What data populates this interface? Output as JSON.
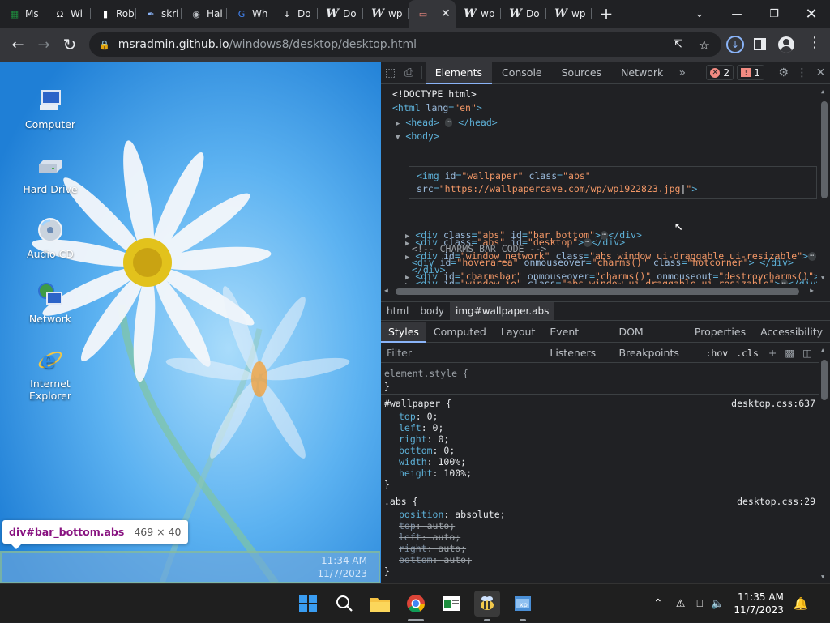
{
  "tabs": [
    {
      "title": "Ms",
      "icon": "green-app-icon",
      "color": "#1e8e3e"
    },
    {
      "title": "Wi",
      "icon": "wiki-icon",
      "color": "#ffffff"
    },
    {
      "title": "Rob",
      "icon": "roblox-icon",
      "color": "#ffffff"
    },
    {
      "title": "skri",
      "icon": "pen-icon",
      "color": "#8ab4f8"
    },
    {
      "title": "Hal",
      "icon": "globe-icon",
      "color": "#bdc1c6"
    },
    {
      "title": "Wh",
      "icon": "google-icon",
      "color": "#4285f4"
    },
    {
      "title": "Do",
      "icon": "download-icon",
      "color": "#e8eaed"
    },
    {
      "title": "Do",
      "icon": "wordpress-w-icon",
      "color": "#e8eaed"
    },
    {
      "title": "wp",
      "icon": "wordpress-w-icon",
      "color": "#e8eaed"
    },
    {
      "title": "",
      "icon": "devtools-screen-icon",
      "color": "#f28b82",
      "active": true
    },
    {
      "title": "wp",
      "icon": "wordpress-w-icon",
      "color": "#e8eaed"
    },
    {
      "title": "Do",
      "icon": "wordpress-w-icon",
      "color": "#e8eaed"
    },
    {
      "title": "wp",
      "icon": "wordpress-w-icon",
      "color": "#e8eaed"
    }
  ],
  "address": {
    "host": "msradmin.github.io",
    "path": "/windows8/desktop/desktop.html"
  },
  "desktop_icons": [
    {
      "label": "Computer",
      "icon": "computer-icon"
    },
    {
      "label": "Hard Drive",
      "icon": "hard-drive-icon"
    },
    {
      "label": "Audio CD",
      "icon": "audio-cd-icon"
    },
    {
      "label": "Network",
      "icon": "network-icon"
    },
    {
      "label": "Internet Explorer",
      "icon": "internet-explorer-icon"
    }
  ],
  "tooltip": {
    "tag": "div#bar_bottom.abs",
    "dims": "469 × 40"
  },
  "page_clock": {
    "time": "11:34 AM",
    "date": "11/7/2023"
  },
  "devtools": {
    "tabs": [
      "Elements",
      "Console",
      "Sources",
      "Network"
    ],
    "errors": "2",
    "issues": "1",
    "breadcrumbs": [
      "html",
      "body",
      "img#wallpaper.abs"
    ],
    "style_tabs": [
      "Styles",
      "Computed",
      "Layout",
      "Event Listeners",
      "DOM Breakpoints",
      "Properties",
      "Accessibility"
    ],
    "filter_placeholder": "Filter",
    "filter_hov": ":hov",
    "filter_cls": ".cls",
    "rule_wallpaper": {
      "selector": "#wallpaper {",
      "source": "desktop.css:637"
    },
    "rule_abs": {
      "selector": ".abs {",
      "source": "desktop.css:29"
    },
    "element_style": "element.style {"
  },
  "taskbar": {
    "time": "11:35 AM",
    "date": "11/7/2023"
  }
}
